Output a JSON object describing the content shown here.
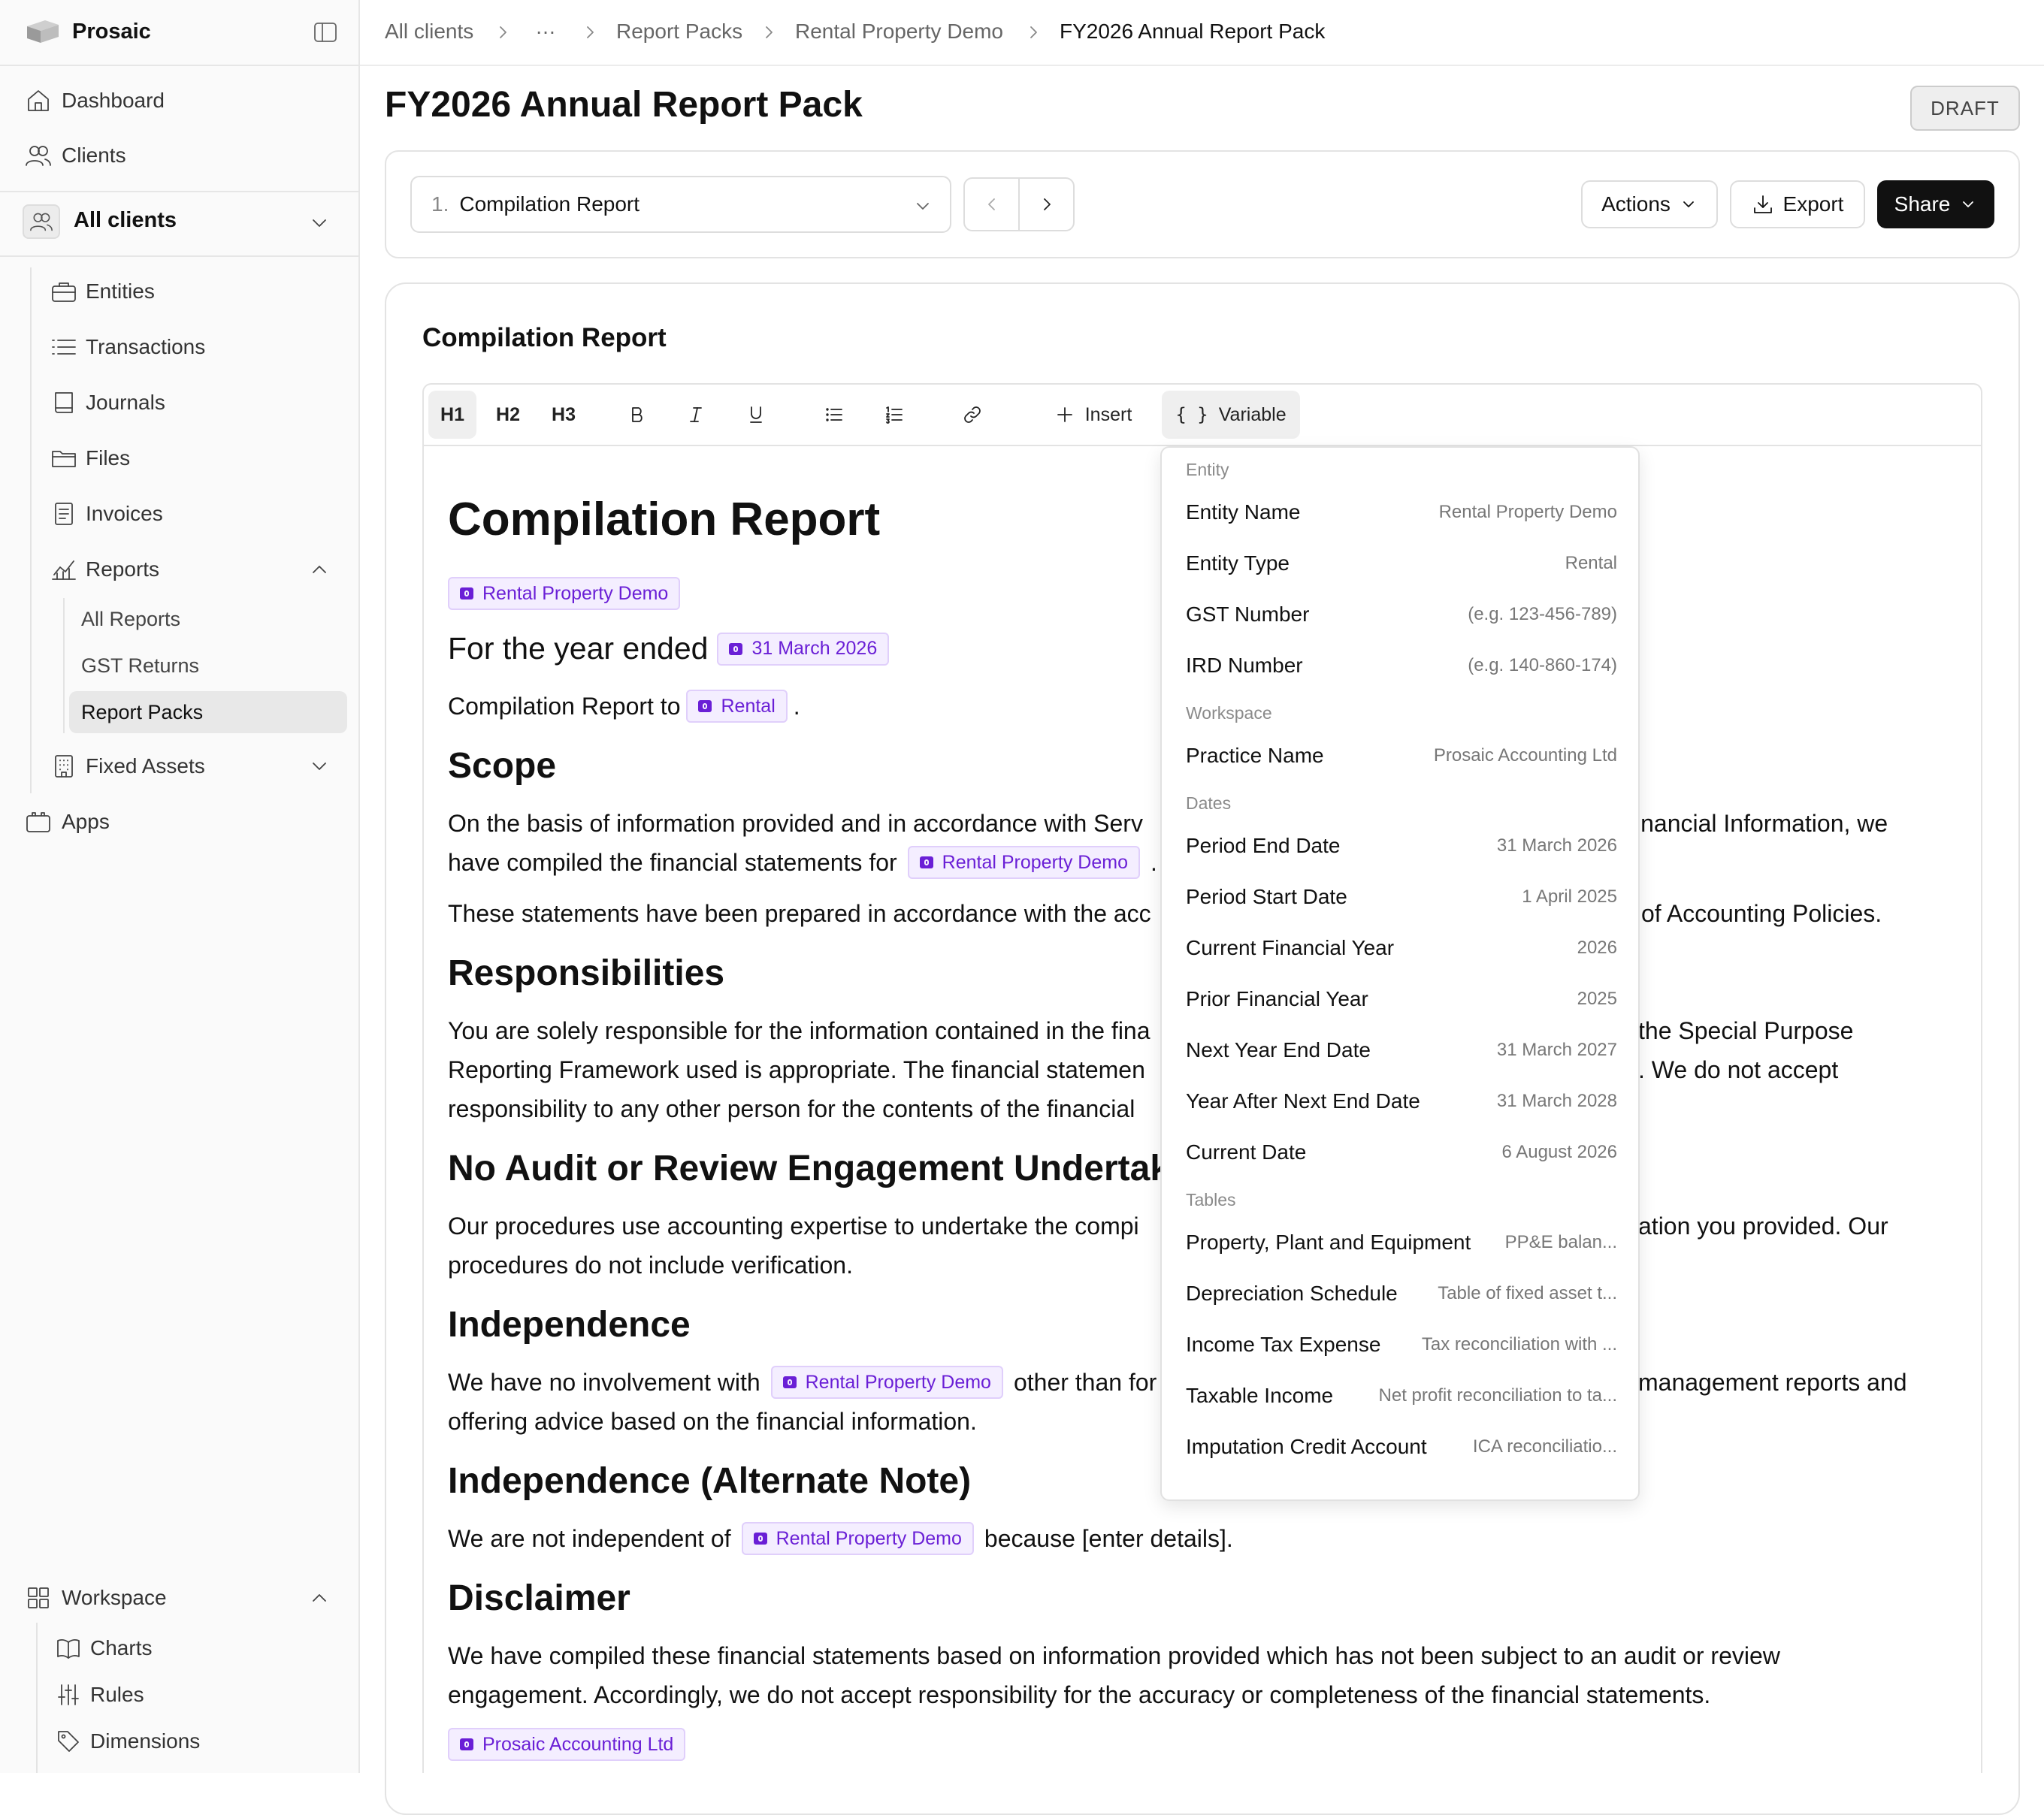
{
  "app": {
    "name": "Prosaic"
  },
  "sidebar": {
    "dashboard": "Dashboard",
    "clients": "Clients",
    "client_selector": "All clients",
    "client_nav": {
      "entities": "Entities",
      "transactions": "Transactions",
      "journals": "Journals",
      "files": "Files",
      "invoices": "Invoices",
      "reports": "Reports",
      "reports_items": [
        "All Reports",
        "GST Returns",
        "Report Packs"
      ],
      "fixed_assets": "Fixed Assets"
    },
    "apps": "Apps",
    "workspace": "Workspace",
    "workspace_items": [
      "Charts",
      "Rules",
      "Dimensions"
    ]
  },
  "breadcrumb": [
    "All clients",
    "…",
    "Report Packs",
    "Rental Property Demo",
    "FY2026 Annual Report Pack"
  ],
  "header": {
    "title": "FY2026 Annual Report Pack",
    "status": "DRAFT"
  },
  "controls": {
    "report_number": "1.",
    "report_name": "Compilation Report",
    "actions": "Actions",
    "export": "Export",
    "share": "Share"
  },
  "editor": {
    "section_title": "Compilation Report",
    "toolbar": {
      "h1": "H1",
      "h2": "H2",
      "h3": "H3",
      "bold": "B",
      "italic": "I",
      "underline": "U",
      "insert": "Insert",
      "variable": "Variable"
    }
  },
  "document": {
    "title": "Compilation Report",
    "entity_chip": "Rental Property Demo",
    "year_ended": "For the year ended",
    "date_chip": "31 March 2026",
    "compilation_to": "Compilation Report to",
    "type_chip": "Rental",
    "period": ".",
    "scope_heading": "Scope",
    "scope_p1_a": "On the basis of information provided and in accordance with Serv",
    "scope_p1_b": "inancial Information, we",
    "scope_p1_c": "have compiled the financial statements for",
    "scope_p1_d": ".",
    "scope_p2_a": "These statements have been prepared in accordance with the acc",
    "scope_p2_b": "of Accounting Policies.",
    "resp_heading": "Responsibilities",
    "resp_1a": "You are solely responsible for the information contained in the fina",
    "resp_1b": "the Special Purpose",
    "resp_2a": "Reporting Framework used is appropriate. The financial statemen",
    "resp_2b": ". We do not accept",
    "resp_3a": "responsibility to any other person for the contents of the financial",
    "noaudit_heading": "No Audit or Review Engagement Undertaken",
    "noaudit_1a": "Our procedures use accounting expertise to undertake the compi",
    "noaudit_1b": "ation you provided. Our",
    "noaudit_2": "procedures do not include verification.",
    "indep_heading": "Independence",
    "indep_1a": "We have no involvement with",
    "indep_1b": "other than for",
    "indep_1c": "management reports and",
    "indep_2": "offering advice based on the financial information.",
    "indep_alt_heading": "Independence (Alternate Note)",
    "indep_alt_a": "We are not independent of",
    "indep_alt_b": "because [enter details].",
    "disclaimer_heading": "Disclaimer",
    "disclaimer_1": "We have compiled these financial statements based on information provided which has not been subject to an audit or review",
    "disclaimer_2": "engagement. Accordingly, we do not accept responsibility for the accuracy or completeness of the financial statements.",
    "practice_chip": "Prosaic Accounting Ltd"
  },
  "variable_menu": {
    "groups": [
      {
        "name": "Entity",
        "items": [
          {
            "label": "Entity Name",
            "value": "Rental Property Demo"
          },
          {
            "label": "Entity Type",
            "value": "Rental"
          },
          {
            "label": "GST Number",
            "value": "(e.g. 123-456-789)"
          },
          {
            "label": "IRD Number",
            "value": "(e.g. 140-860-174)"
          }
        ]
      },
      {
        "name": "Workspace",
        "items": [
          {
            "label": "Practice Name",
            "value": "Prosaic Accounting Ltd"
          }
        ]
      },
      {
        "name": "Dates",
        "items": [
          {
            "label": "Period End Date",
            "value": "31 March 2026"
          },
          {
            "label": "Period Start Date",
            "value": "1 April 2025"
          },
          {
            "label": "Current Financial Year",
            "value": "2026"
          },
          {
            "label": "Prior Financial Year",
            "value": "2025"
          },
          {
            "label": "Next Year End Date",
            "value": "31 March 2027"
          },
          {
            "label": "Year After Next End Date",
            "value": "31 March 2028"
          },
          {
            "label": "Current Date",
            "value": "6 August 2026"
          }
        ]
      },
      {
        "name": "Tables",
        "items": [
          {
            "label": "Property, Plant and Equipment",
            "value": "PP&E balan..."
          },
          {
            "label": "Depreciation Schedule",
            "value": "Table of fixed asset t..."
          },
          {
            "label": "Income Tax Expense",
            "value": "Tax reconciliation with ..."
          },
          {
            "label": "Taxable Income",
            "value": "Net profit reconciliation to ta..."
          },
          {
            "label": "Imputation Credit Account",
            "value": "ICA reconciliatio..."
          }
        ]
      }
    ]
  },
  "colors": {
    "variable_chip_text": "#6a1fd6",
    "variable_chip_bg": "#f4eeff",
    "share_button_bg": "#111111"
  }
}
